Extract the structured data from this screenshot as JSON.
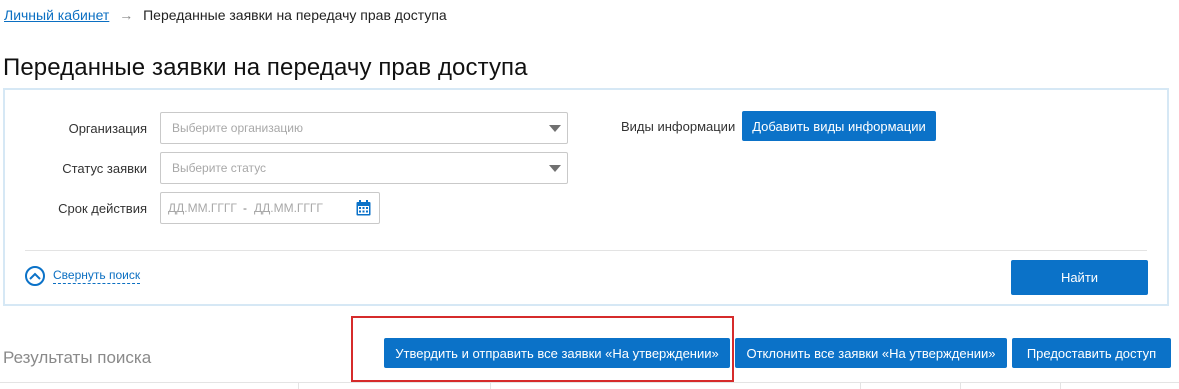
{
  "breadcrumb": {
    "link": "Личный кабинет",
    "arrow": "→",
    "current": "Переданные заявки на передачу прав доступа"
  },
  "page_title": "Переданные заявки на передачу прав доступа",
  "filters": {
    "organization": {
      "label": "Организация",
      "placeholder": "Выберите организацию"
    },
    "status": {
      "label": "Статус заявки",
      "placeholder": "Выберите статус"
    },
    "period": {
      "label": "Срок действия",
      "from_placeholder": "ДД.ММ.ГГГГ",
      "separator": "-",
      "to_placeholder": "ДД.ММ.ГГГГ"
    },
    "info_types": {
      "label": "Виды информации",
      "button": "Добавить виды информации"
    }
  },
  "collapse_label": "Свернуть поиск",
  "find_button": "Найти",
  "results_title": "Результаты поиска",
  "actions": {
    "approve_all": "Утвердить и отправить все заявки «На утверждении»",
    "reject_all": "Отклонить все заявки «На утверждении»",
    "grant_access": "Предоставить доступ"
  },
  "colors": {
    "accent": "#0b72c8",
    "link": "#0b6fc2",
    "highlight": "#d62b2b",
    "panel_border": "#d6e8f5"
  },
  "icons": [
    "arrow-right-icon",
    "dropdown-arrow-icon",
    "calendar-icon",
    "chevron-up-icon"
  ]
}
